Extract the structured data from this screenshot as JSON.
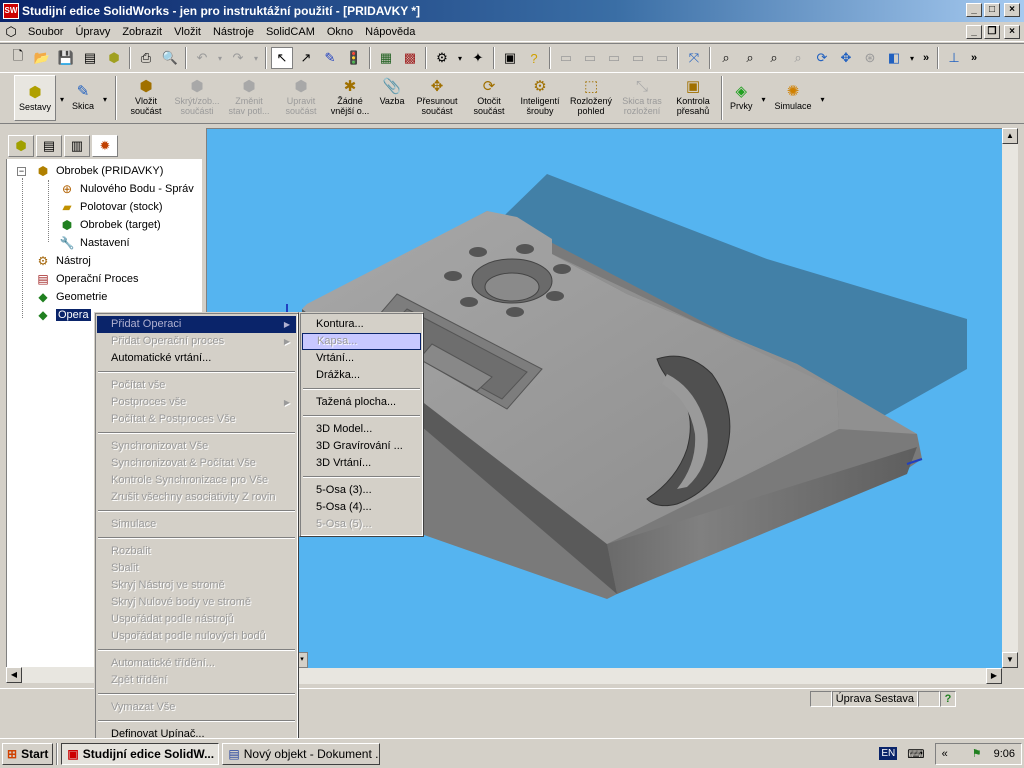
{
  "window": {
    "title": "Studijní edice SolidWorks - jen pro instruktážní použití - [PRIDAVKY *]"
  },
  "menubar": [
    "Soubor",
    "Úpravy",
    "Zobrazit",
    "Vložit",
    "Nástroje",
    "SolidCAM",
    "Okno",
    "Nápověda"
  ],
  "command_manager": {
    "sestavy": "Sestavy",
    "skica": "Skica",
    "buttons": [
      {
        "label1": "Vložit",
        "label2": "součást",
        "enabled": true,
        "icon": "insert-part-icon"
      },
      {
        "label1": "Skrýt/zob...",
        "label2": "součásti",
        "enabled": false,
        "icon": "hide-show-icon"
      },
      {
        "label1": "Změnit",
        "label2": "stav potl...",
        "enabled": false,
        "icon": "change-state-icon"
      },
      {
        "label1": "Upravit",
        "label2": "součást",
        "enabled": false,
        "icon": "edit-part-icon"
      },
      {
        "label1": "Žádné",
        "label2": "vnější o...",
        "enabled": true,
        "icon": "no-external-icon"
      },
      {
        "label1": "Vazba",
        "label2": "",
        "enabled": true,
        "icon": "mate-icon"
      },
      {
        "label1": "Přesunout",
        "label2": "součást",
        "enabled": true,
        "icon": "move-part-icon"
      },
      {
        "label1": "Otočit",
        "label2": "součást",
        "enabled": true,
        "icon": "rotate-part-icon"
      },
      {
        "label1": "Inteligentí",
        "label2": "šrouby",
        "enabled": true,
        "icon": "smart-fasteners-icon"
      },
      {
        "label1": "Rozložený",
        "label2": "pohled",
        "enabled": true,
        "icon": "exploded-view-icon"
      },
      {
        "label1": "Skica tras",
        "label2": "rozložení",
        "enabled": false,
        "icon": "explode-line-icon"
      },
      {
        "label1": "Kontrola",
        "label2": "přesahů",
        "enabled": true,
        "icon": "interference-icon"
      }
    ],
    "prvky": "Prvky",
    "simulace": "Simulace"
  },
  "tree": {
    "items": [
      {
        "label": "Obrobek (PRIDAVKY)",
        "icon": "assembly-icon"
      },
      {
        "label": "Nulového Bodu - Správ",
        "icon": "origin-icon"
      },
      {
        "label": "Polotovar (stock)",
        "icon": "stock-icon"
      },
      {
        "label": "Obrobek (target)",
        "icon": "target-icon"
      },
      {
        "label": "Nastavení",
        "icon": "settings-icon"
      },
      {
        "label": "Nástroj",
        "icon": "tool-icon"
      },
      {
        "label": "Operační Proces",
        "icon": "process-icon"
      },
      {
        "label": "Geometrie",
        "icon": "geometry-icon"
      },
      {
        "label": "Opera",
        "icon": "operations-icon"
      }
    ]
  },
  "context_menu": [
    {
      "label": "Přidat Operaci",
      "enabled": false,
      "submenu": true,
      "highlight": true
    },
    {
      "label": "Přidat Operační proces",
      "enabled": false,
      "submenu": true
    },
    {
      "label": "Automatické vrtání...",
      "enabled": true
    },
    {
      "sep": true
    },
    {
      "label": "Počítat vše",
      "enabled": false
    },
    {
      "label": "Postproces vše",
      "enabled": false,
      "submenu": true
    },
    {
      "label": "Počítat & Postproces Vše",
      "enabled": false
    },
    {
      "sep": true
    },
    {
      "label": "Synchronizovat Vše",
      "enabled": false
    },
    {
      "label": "Synchronizovat & Počítat Vše",
      "enabled": false
    },
    {
      "label": "Kontrole Synchronizace pro Vše",
      "enabled": false
    },
    {
      "label": "Zrušit všechny asociativity Z rovin",
      "enabled": false
    },
    {
      "sep": true
    },
    {
      "label": "Simulace",
      "enabled": false
    },
    {
      "sep": true
    },
    {
      "label": "Rozbalit",
      "enabled": false
    },
    {
      "label": "Sbalit",
      "enabled": false
    },
    {
      "label": "Skryj Nástroj ve stromě",
      "enabled": false
    },
    {
      "label": "Skryj Nulové body ve stromě",
      "enabled": false
    },
    {
      "label": "Uspořádat podle nástrojů",
      "enabled": false
    },
    {
      "label": "Uspořádat podle nulových bodů",
      "enabled": false
    },
    {
      "sep": true
    },
    {
      "label": "Automatické třídění...",
      "enabled": false
    },
    {
      "label": "Zpět třídění",
      "enabled": false
    },
    {
      "sep": true
    },
    {
      "label": "Vymazat Vše",
      "enabled": false
    },
    {
      "sep": true
    },
    {
      "label": "Definovat Upínač...",
      "enabled": true
    }
  ],
  "submenu": [
    {
      "label": "Kontura...",
      "enabled": true
    },
    {
      "label": "Kapsa...",
      "enabled": false,
      "highlight": true
    },
    {
      "label": "Vrtání...",
      "enabled": true
    },
    {
      "label": "Drážka...",
      "enabled": true
    },
    {
      "sep": true
    },
    {
      "label": "Tažená plocha...",
      "enabled": true
    },
    {
      "sep": true
    },
    {
      "label": "3D Model...",
      "enabled": true
    },
    {
      "label": "3D Gravírování ...",
      "enabled": true
    },
    {
      "label": "3D Vrtání...",
      "enabled": true
    },
    {
      "sep": true
    },
    {
      "label": "5-Osa (3)...",
      "enabled": true
    },
    {
      "label": "5-Osa (4)...",
      "enabled": true
    },
    {
      "label": "5-Osa (5)...",
      "enabled": false
    }
  ],
  "status": {
    "edit": "Úprava Sestava",
    "help": "?"
  },
  "taskbar": {
    "start": "Start",
    "tasks": [
      "Studijní edice SolidW...",
      "Nový objekt - Dokument ..."
    ],
    "lang": "EN",
    "chevron": "«",
    "clock": "9:06"
  }
}
